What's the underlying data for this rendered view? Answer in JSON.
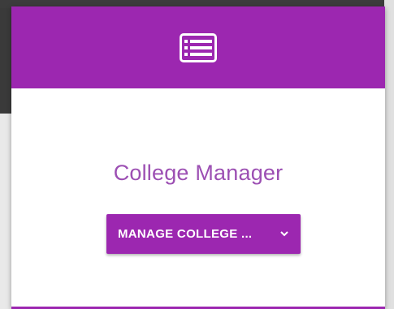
{
  "card": {
    "header_icon": "list-icon",
    "title": "College Manager",
    "dropdown_label": "MANAGE COLLEGE ...",
    "dropdown_icon": "chevron-down-icon"
  },
  "colors": {
    "accent": "#9c27b0",
    "title_text": "#9c4fb3",
    "card_background": "#ffffff"
  }
}
